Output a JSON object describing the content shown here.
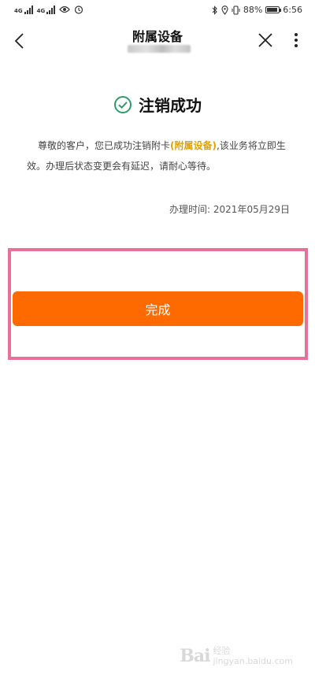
{
  "status_bar": {
    "sim1_label": "4G",
    "sim2_label": "4G",
    "battery": "88%",
    "time": "6:56"
  },
  "nav": {
    "title": "附属设备",
    "back_icon": "chevron-left-icon",
    "close_icon": "close-icon",
    "more_icon": "more-vertical-icon"
  },
  "result": {
    "icon": "check-circle-icon",
    "icon_color": "#2a9d6b",
    "title": "注销成功",
    "message_part1": "尊敬的客户，您已成功注销附卡",
    "message_highlight": "(附属设备)",
    "message_part2": ",该业务将立即生效。办理后状态变更会有延迟，请耐心等待。",
    "time_label": "办理时间: ",
    "time_value": "2021年05月29日"
  },
  "actions": {
    "done_label": "完成",
    "done_color": "#ff6a00"
  },
  "annotation": {
    "highlight_color": "#e8719a"
  },
  "watermark": {
    "logo": "Bai",
    "line1": "经验",
    "line2": "jingyan.baidu.com"
  }
}
